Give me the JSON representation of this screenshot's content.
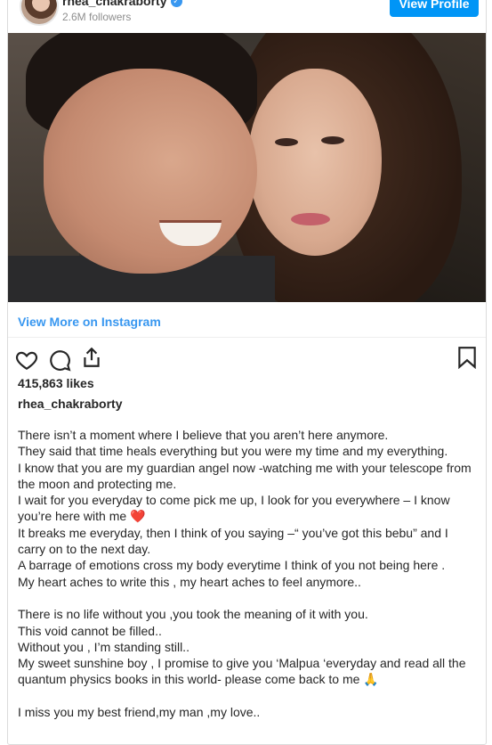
{
  "header": {
    "username": "rhea_chakraborty",
    "followers": "2.6M followers",
    "view_profile_label": "View Profile"
  },
  "link": {
    "view_more": "View More on Instagram"
  },
  "post": {
    "likes": "415,863 likes",
    "caption_user": "rhea_chakraborty",
    "caption_lines": [
      "There isn’t a moment where I believe that you aren’t here anymore.",
      "They said that time heals everything but you were my time and my everything.",
      "I know that you are my guardian angel now -watching me with your telescope from",
      "the moon and protecting me.",
      "I wait for you everyday to come pick me up, I look for you everywhere – I know",
      "you’re here with me ❤️",
      "It breaks me everyday, then I think of you saying –“ you’ve got this bebu” and I",
      "carry on to the next day.",
      "A barrage of emotions cross my body everytime I think of you not being here .",
      "My heart aches to write this , my heart aches to feel anymore..",
      "",
      "There is no life without you ,you took the meaning of it with you.",
      "This void cannot be filled..",
      "Without you , I’m standing still..",
      "My sweet sunshine boy , I promise to give you ‘Malpua ‘everyday and read all the",
      "quantum physics books in this world- please come back to me 🙏",
      "",
      "I miss you my best friend,my man ,my love.."
    ]
  },
  "icons": {
    "like": "heart-icon",
    "comment": "comment-icon",
    "share": "share-icon",
    "save": "bookmark-icon"
  },
  "colors": {
    "accent": "#0095f6",
    "link": "#3897f0",
    "verified": "#3897f0"
  }
}
